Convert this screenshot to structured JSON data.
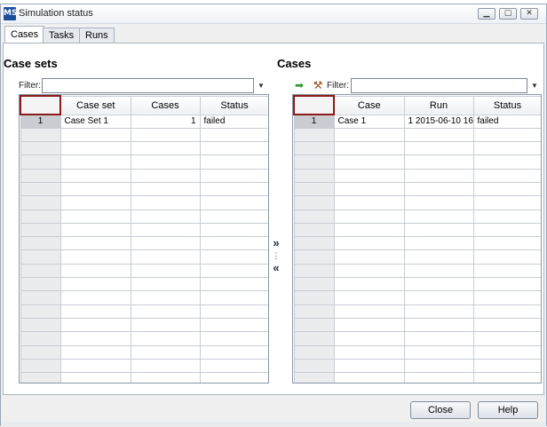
{
  "window": {
    "title": "Simulation status",
    "icon_label": "MS"
  },
  "tabs": [
    {
      "label": "Cases",
      "active": true
    },
    {
      "label": "Tasks",
      "active": false
    },
    {
      "label": "Runs",
      "active": false
    }
  ],
  "left_panel": {
    "title": "Case sets",
    "filter_label": "Filter:",
    "filter_value": "",
    "columns": [
      "",
      "Case set",
      "Cases",
      "Status"
    ],
    "rows": [
      {
        "num": "1",
        "case_set": "Case Set 1",
        "cases": "1",
        "status": "failed"
      }
    ]
  },
  "right_panel": {
    "title": "Cases",
    "filter_label": "Filter:",
    "filter_value": "",
    "columns": [
      "",
      "Case",
      "Run",
      "Status"
    ],
    "rows": [
      {
        "num": "1",
        "case": "Case 1",
        "run": "1 2015-06-10 16:",
        "status": "failed"
      }
    ]
  },
  "mover": {
    "add": "»",
    "separator": "⋮",
    "remove": "«"
  },
  "buttons": {
    "close": "Close",
    "help": "Help"
  },
  "icons": {
    "add_case": "green-arrow-icon",
    "tools": "hammer-icon"
  }
}
